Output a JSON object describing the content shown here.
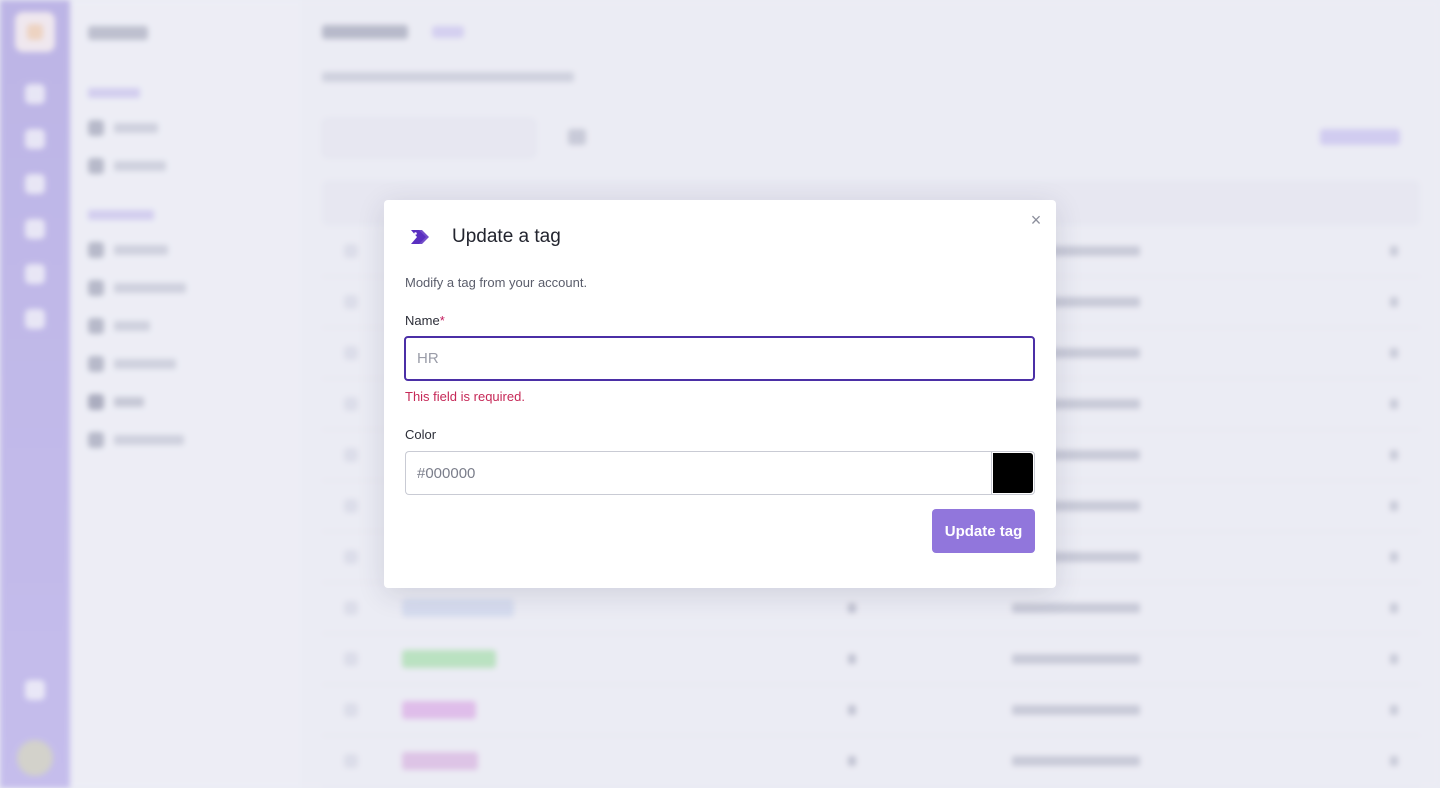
{
  "modal": {
    "title": "Update a tag",
    "description": "Modify a tag from your account.",
    "name_label": "Name",
    "required_mark": "*",
    "name_placeholder": "HR",
    "name_value": "",
    "name_error": "This field is required.",
    "color_label": "Color",
    "color_placeholder": "#000000",
    "color_value": "",
    "swatch_color": "#000000",
    "submit_label": "Update tag",
    "close_glyph": "×",
    "accent_color": "#4b2fa6"
  },
  "background": {
    "rows": [
      {
        "chip_color": ""
      },
      {
        "chip_color": ""
      },
      {
        "chip_color": ""
      },
      {
        "chip_color": ""
      },
      {
        "chip_color": ""
      },
      {
        "chip_color": ""
      },
      {
        "chip_color": ""
      },
      {
        "chip_color": "#cfd8ef"
      },
      {
        "chip_color": "#a4e0a8"
      },
      {
        "chip_color": "#dca8e6"
      },
      {
        "chip_color": "#d9b2e0"
      }
    ]
  }
}
